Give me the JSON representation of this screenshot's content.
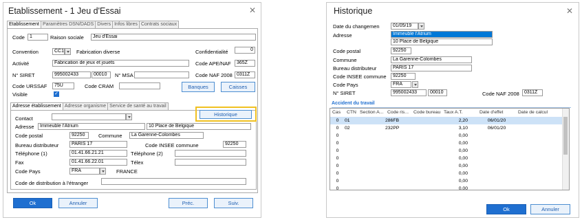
{
  "left": {
    "title": "Etablissement - 1 Jeu d'Essai",
    "tabs": [
      "Etablissement",
      "Paramètres DSN/DADS",
      "Divers",
      "Infos libres",
      "Contrats sociaux"
    ],
    "code_label": "Code",
    "code_value": "1",
    "raison_label": "Raison sociale",
    "raison_value": "Jeu d'Essai",
    "convention_label": "Convention",
    "convention_code": "CC1",
    "convention_name": "Fabrication diverse",
    "confidentialite_label": "Confidentialité",
    "confidentialite_value": "0",
    "activite_label": "Activité",
    "activite_value": "Fabrication de jeux et jouets",
    "ape_label": "Code APE/NAF",
    "ape_value": "365Z",
    "siret_label": "N° SIRET",
    "siret_value": "995002433",
    "siret_suffix": "00010",
    "msa_label": "N° MSA",
    "naf2008_label": "Code NAF 2008",
    "naf2008_value": "0311Z",
    "urssaf_label": "Code URSSAF",
    "urssaf_value": "75U",
    "cram_label": "Code CRAM",
    "banques_label": "Banques",
    "caisses_label": "Caisses",
    "visible_label": "Visible",
    "subtabs": [
      "Adresse établissement",
      "Adresse organisme",
      "Service de santé au travail"
    ],
    "historique_label": "Historique",
    "contact_label": "Contact",
    "adresse_label": "Adresse",
    "adresse_value": "Immeuble l'Atrium",
    "adresse2_value": "10 Place de Belgique",
    "cp_label": "Code postal",
    "cp_value": "92250",
    "commune_label": "Commune",
    "commune_value": "La Garenne-Colombes",
    "bureau_label": "Bureau distributeur",
    "bureau_value": "PARIS 17",
    "insee_label": "Code INSEE commune",
    "insee_value": "92250",
    "tel1_label": "Téléphone (1)",
    "tel1_value": "01.41.66.21.21",
    "tel2_label": "Téléphone (2)",
    "fax_label": "Fax",
    "fax_value": "01.41.66.22.01",
    "telex_label": "Télex",
    "pays_label": "Code Pays",
    "pays_value": "FRA",
    "pays_name": "FRANCE",
    "distrib_label": "Code de distribution à l'étranger",
    "ok_label": "Ok",
    "annuler_label": "Annuler",
    "prec_label": "Préc.",
    "suiv_label": "Suiv."
  },
  "right": {
    "title": "Historique",
    "date_label": "Date du changemen",
    "date_value": "01/05/19",
    "adresse_label": "Adresse",
    "adresse_value": "Immeuble l'Atrium",
    "adresse2_value": "10 Place de Belgique",
    "cp_label": "Code postal",
    "cp_value": "92250",
    "commune_label": "Commune",
    "commune_value": "La Garenne-Colombes",
    "bureau_label": "Bureau distributeur",
    "bureau_value": "PARIS 17",
    "insee_label": "Code INSEE commune",
    "insee_value": "92250",
    "pays_label": "Code Pays",
    "pays_value": "FRA",
    "siret_label": "N° SIRET",
    "siret_value": "995002433",
    "siret_suffix": "00010",
    "naf_label": "Code NAF 2008",
    "naf_value": "0311Z",
    "section_label": "Accident du travail",
    "columns": [
      "Cas",
      "CTN",
      "Section A...",
      "Code ris...",
      "Code bureau",
      "Taux A.T.",
      "Date d'effet",
      "Date de calcul"
    ],
    "rows": [
      [
        "0",
        "01",
        "",
        "286FB",
        "",
        "2,20",
        "06/01/20",
        ""
      ],
      [
        "0",
        "02",
        "",
        "232PP",
        "",
        "3,10",
        "06/01/20",
        ""
      ],
      [
        "0",
        "",
        "",
        "",
        "",
        "0,00",
        "",
        ""
      ],
      [
        "0",
        "",
        "",
        "",
        "",
        "0,00",
        "",
        ""
      ],
      [
        "0",
        "",
        "",
        "",
        "",
        "0,00",
        "",
        ""
      ],
      [
        "0",
        "",
        "",
        "",
        "",
        "0,00",
        "",
        ""
      ],
      [
        "0",
        "",
        "",
        "",
        "",
        "0,00",
        "",
        ""
      ],
      [
        "0",
        "",
        "",
        "",
        "",
        "0,00",
        "",
        ""
      ],
      [
        "0",
        "",
        "",
        "",
        "",
        "0,00",
        "",
        ""
      ],
      [
        "0",
        "",
        "",
        "",
        "",
        "0,00",
        "",
        ""
      ]
    ],
    "ok_label": "Ok",
    "annuler_label": "Annuler"
  }
}
